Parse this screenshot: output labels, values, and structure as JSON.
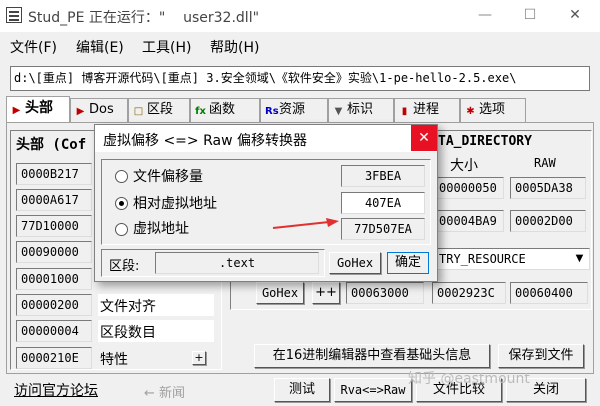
{
  "window": {
    "title": "Stud_PE 正在运行：\"    user32.dll\"",
    "minimize": "—",
    "maximize": "☐",
    "close": "✕"
  },
  "menu": [
    "文件(F)",
    "编辑(E)",
    "工具(H)",
    "帮助(H)"
  ],
  "path": "d:\\[重点] 博客开源代码\\[重点] 3.安全领域\\《软件安全》实验\\1-pe-hello-2.5.exe\\",
  "tabs": [
    {
      "label": "头部",
      "icon": "▶",
      "color": "#c00000"
    },
    {
      "label": "Dos",
      "icon": "▶",
      "color": "#c00000"
    },
    {
      "label": "区段",
      "icon": "□",
      "color": "#806000"
    },
    {
      "label": "函数",
      "icon": "fx",
      "color": "#008000"
    },
    {
      "label": "资源",
      "icon": "Rs",
      "color": "#0000c0"
    },
    {
      "label": "标识",
      "icon": "▼",
      "color": "#555555"
    },
    {
      "label": "进程",
      "icon": "▮",
      "color": "#c00000"
    },
    {
      "label": "选项",
      "icon": "✱",
      "color": "#c00000"
    }
  ],
  "left": {
    "header": "头部 (Cof",
    "values": [
      "0000B217",
      "0000A617",
      "77D10000",
      "00090000",
      "00001000",
      "00000200",
      "00000004",
      "0000210E"
    ],
    "labels": [
      "",
      "",
      "",
      "",
      "",
      "文件对齐",
      "区段数目",
      "特性"
    ],
    "plus": "+"
  },
  "right": {
    "header": "TA_DIRECTORY",
    "col_size": "大小",
    "col_raw": "RAW",
    "rows": [
      [
        "00000050",
        "0005DA38"
      ],
      [
        "00004BA9",
        "00002D00"
      ]
    ],
    "dropdown": "TRY_RESOURCE",
    "gohex": "GoHex",
    "plusplus": "++",
    "bottom_values": [
      "00063000",
      "0002923C",
      "00060400"
    ]
  },
  "dialog": {
    "title": "虚拟偏移 <=> Raw 偏移转换器",
    "close": "✕",
    "options": [
      {
        "label": "文件偏移量",
        "value": "3FBEA"
      },
      {
        "label": "相对虚拟地址",
        "value": "407EA"
      },
      {
        "label": "虚拟地址",
        "value": "77D507EA"
      }
    ],
    "section_label": "区段:",
    "section_value": ".text",
    "gohex": "GoHex",
    "ok": "确定"
  },
  "buttons": {
    "view_hex": "在16进制编辑器中查看基础头信息",
    "save": "保存到文件",
    "test": "测试",
    "rva": "Rva<=>Raw",
    "file_compare": "文件比较",
    "close": "关闭"
  },
  "footer": {
    "forum": "访问官方论坛",
    "news": "← 新闻"
  },
  "watermark": "知乎 @eastmount",
  "colors": {
    "accent": "#e81123",
    "arrow": "#e03030"
  }
}
